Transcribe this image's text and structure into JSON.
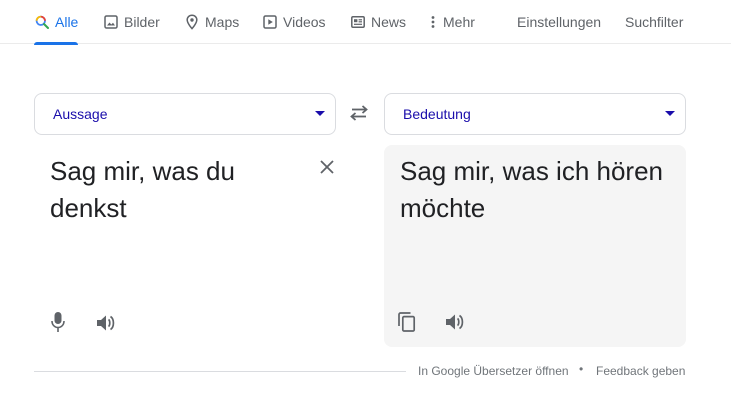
{
  "nav": {
    "tabs": [
      {
        "label": "Alle",
        "icon": "search-icon",
        "active": true
      },
      {
        "label": "Bilder",
        "icon": "image-icon",
        "active": false
      },
      {
        "label": "Maps",
        "icon": "map-pin-icon",
        "active": false
      },
      {
        "label": "Videos",
        "icon": "video-icon",
        "active": false
      },
      {
        "label": "News",
        "icon": "news-icon",
        "active": false
      },
      {
        "label": "Mehr",
        "icon": "more-vert-icon",
        "active": false
      }
    ],
    "tools": {
      "settings": "Einstellungen",
      "filter": "Suchfilter"
    }
  },
  "translator": {
    "source_lang": "Aussage",
    "target_lang": "Bedeutung",
    "source_text": "Sag mir, was du denkst",
    "target_text": "Sag mir, was ich hören möchte"
  },
  "footer": {
    "open_link": "In Google Übersetzer öffnen",
    "separator": "•",
    "feedback_link": "Feedback geben"
  },
  "colors": {
    "accent": "#1a73e8",
    "lang_text": "#1a0dab",
    "target_bg": "#f5f5f5"
  }
}
